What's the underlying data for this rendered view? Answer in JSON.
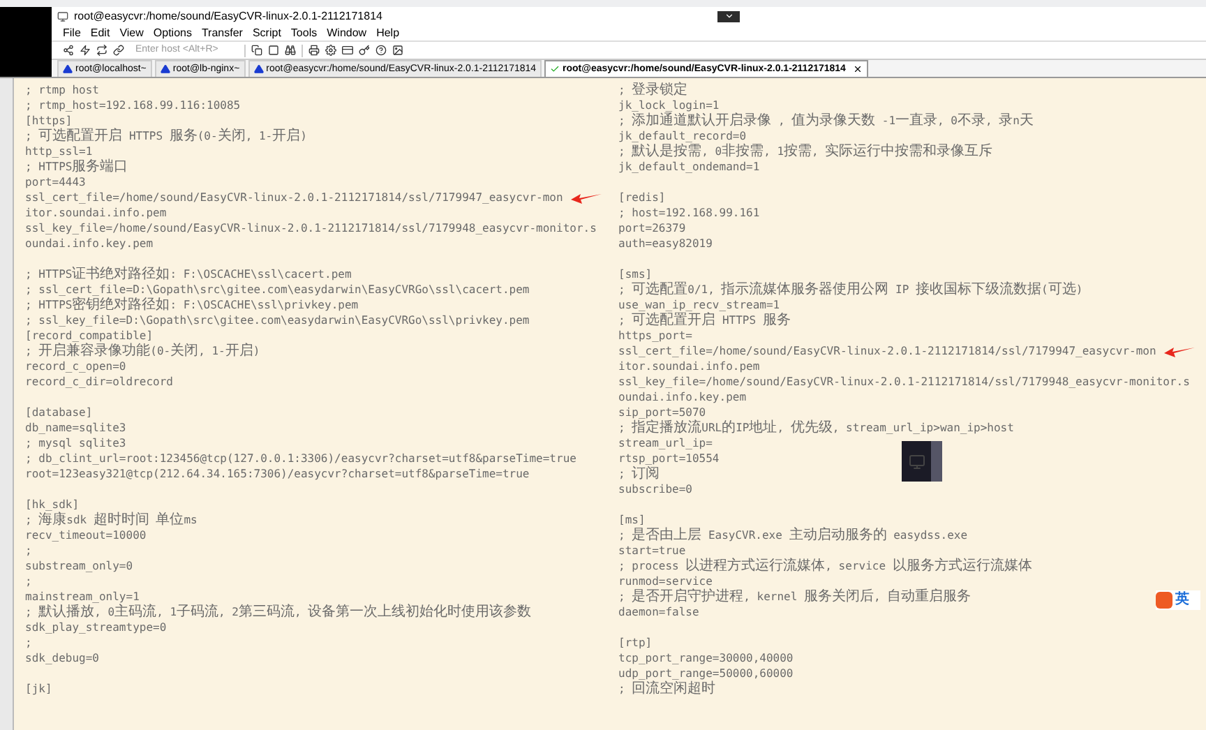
{
  "window": {
    "title": "root@easycvr:/home/sound/EasyCVR-linux-2.0.1-2112171814"
  },
  "menu": [
    "File",
    "Edit",
    "View",
    "Options",
    "Transfer",
    "Script",
    "Tools",
    "Window",
    "Help"
  ],
  "toolbar": {
    "host_field": {
      "placeholder": "Enter host <Alt+R>"
    }
  },
  "tabs": [
    {
      "label": "root@localhost~",
      "kind": "warning",
      "selected": false
    },
    {
      "label": "root@lb-nginx~",
      "kind": "warning",
      "selected": false
    },
    {
      "label": "root@easycvr:/home/sound/EasyCVR-linux-2.0.1-2112171814",
      "kind": "warning",
      "selected": false
    },
    {
      "label": "root@easycvr:/home/sound/EasyCVR-linux-2.0.1-2112171814",
      "kind": "connected",
      "selected": true
    }
  ],
  "terminal": {
    "lines": [
      {
        "kind": "text",
        "text": "; rtmp host"
      },
      {
        "kind": "text",
        "text": "; rtmp_host=192.168.99.116:10085"
      },
      {
        "kind": "text",
        "text": "[https]"
      },
      {
        "kind": "text",
        "text": "; 可选配置开启 HTTPS 服务(0-关闭, 1-开启)"
      },
      {
        "kind": "text",
        "text": "http_ssl=1"
      },
      {
        "kind": "text",
        "text": "; HTTPS服务端口"
      },
      {
        "kind": "text",
        "text": "port=4443"
      },
      {
        "kind": "arrowed",
        "text": "ssl_cert_file=/home/sound/EasyCVR-linux-2.0.1-2112171814/ssl/7179947_easycvr-monitor.soundai.info.pem"
      },
      {
        "kind": "text",
        "text": "ssl_key_file=/home/sound/EasyCVR-linux-2.0.1-2112171814/ssl/7179948_easycvr-monitor.soundai.info.key.pem"
      },
      {
        "kind": "blank"
      },
      {
        "kind": "text",
        "text": "; HTTPS证书绝对路径如: F:\\OSCACHE\\ssl\\cacert.pem"
      },
      {
        "kind": "text",
        "text": "; ssl_cert_file=D:\\Gopath\\src\\gitee.com\\easydarwin\\EasyCVRGo\\ssl\\cacert.pem"
      },
      {
        "kind": "text",
        "text": "; HTTPS密钥绝对路径如: F:\\OSCACHE\\ssl\\privkey.pem"
      },
      {
        "kind": "text",
        "text": "; ssl_key_file=D:\\Gopath\\src\\gitee.com\\easydarwin\\EasyCVRGo\\ssl\\privkey.pem"
      },
      {
        "kind": "text",
        "text": "[record_compatible]"
      },
      {
        "kind": "text",
        "text": "; 开启兼容录像功能(0-关闭, 1-开启)"
      },
      {
        "kind": "text",
        "text": "record_c_open=0"
      },
      {
        "kind": "text",
        "text": "record_c_dir=oldrecord"
      },
      {
        "kind": "blank"
      },
      {
        "kind": "text",
        "text": "[database]"
      },
      {
        "kind": "text",
        "text": "db_name=sqlite3"
      },
      {
        "kind": "text",
        "text": "; mysql sqlite3"
      },
      {
        "kind": "text",
        "text": "; db_clint_url=root:123456@tcp(127.0.0.1:3306)/easycvr?charset=utf8&parseTime=true"
      },
      {
        "kind": "text",
        "text": "root=123easy321@tcp(212.64.34.165:7306)/easycvr?charset=utf8&parseTime=true"
      },
      {
        "kind": "blank"
      },
      {
        "kind": "text",
        "text": "[hk_sdk]"
      },
      {
        "kind": "text",
        "text": "; 海康sdk 超时时间 单位ms"
      },
      {
        "kind": "text",
        "text": "recv_timeout=10000"
      },
      {
        "kind": "text",
        "text": ";"
      },
      {
        "kind": "text",
        "text": "substream_only=0"
      },
      {
        "kind": "text",
        "text": ";"
      },
      {
        "kind": "text",
        "text": "mainstream_only=1"
      },
      {
        "kind": "text",
        "text": "; 默认播放, 0主码流, 1子码流, 2第三码流, 设备第一次上线初始化时使用该参数"
      },
      {
        "kind": "text",
        "text": "sdk_play_streamtype=0"
      },
      {
        "kind": "text",
        "text": ";"
      },
      {
        "kind": "text",
        "text": "sdk_debug=0"
      },
      {
        "kind": "blank"
      },
      {
        "kind": "text",
        "text": "[jk]"
      },
      {
        "kind": "text",
        "text": "; 登录锁定"
      },
      {
        "kind": "text",
        "text": "jk_lock_login=1"
      },
      {
        "kind": "text",
        "text": "; 添加通道默认开启录像 , 值为录像天数 -1一直录, 0不录, 录n天"
      },
      {
        "kind": "text",
        "text": "jk_default_record=0"
      },
      {
        "kind": "text",
        "text": "; 默认是按需, 0非按需, 1按需, 实际运行中按需和录像互斥"
      },
      {
        "kind": "text",
        "text": "jk_default_ondemand=1"
      },
      {
        "kind": "blank"
      },
      {
        "kind": "text",
        "text": "[redis]"
      },
      {
        "kind": "text",
        "text": "; host=192.168.99.161"
      },
      {
        "kind": "text",
        "text": "port=26379"
      },
      {
        "kind": "text",
        "text": "auth=easy82019"
      },
      {
        "kind": "blank"
      },
      {
        "kind": "text",
        "text": "[sms]"
      },
      {
        "kind": "text",
        "text": "; 可选配置0/1, 指示流媒体服务器使用公网 IP 接收国标下级流数据(可选)"
      },
      {
        "kind": "text",
        "text": "use_wan_ip_recv_stream=1"
      },
      {
        "kind": "text",
        "text": "; 可选配置开启 HTTPS 服务"
      },
      {
        "kind": "text",
        "text": "https_port="
      },
      {
        "kind": "arrowed",
        "text": "ssl_cert_file=/home/sound/EasyCVR-linux-2.0.1-2112171814/ssl/7179947_easycvr-monitor.soundai.info.pem"
      },
      {
        "kind": "text",
        "text": "ssl_key_file=/home/sound/EasyCVR-linux-2.0.1-2112171814/ssl/7179948_easycvr-monitor.soundai.info.key.pem"
      },
      {
        "kind": "text",
        "text": "sip_port=5070"
      },
      {
        "kind": "text",
        "text": "; 指定播放流URL的IP地址, 优先级, stream_url_ip>wan_ip>host"
      },
      {
        "kind": "text",
        "text": "stream_url_ip="
      },
      {
        "kind": "text",
        "text": "rtsp_port=10554"
      },
      {
        "kind": "text",
        "text": "; 订阅"
      },
      {
        "kind": "text",
        "text": "subscribe=0"
      },
      {
        "kind": "blank"
      },
      {
        "kind": "text",
        "text": "[ms]"
      },
      {
        "kind": "text",
        "text": "; 是否由上层 EasyCVR.exe 主动启动服务的 easydss.exe"
      },
      {
        "kind": "text",
        "text": "start=true"
      },
      {
        "kind": "text",
        "text": "; process 以进程方式运行流媒体, service 以服务方式运行流媒体"
      },
      {
        "kind": "text",
        "text": "runmod=service"
      },
      {
        "kind": "text",
        "text": "; 是否开启守护进程, kernel 服务关闭后, 自动重启服务"
      },
      {
        "kind": "text",
        "text": "daemon=false"
      },
      {
        "kind": "blank"
      },
      {
        "kind": "text",
        "text": "[rtp]"
      },
      {
        "kind": "text",
        "text": "tcp_port_range=30000,40000"
      },
      {
        "kind": "text",
        "text": "udp_port_range=50000,60000"
      },
      {
        "kind": "text",
        "text": "; 回流空闲超时"
      }
    ]
  },
  "ime": {
    "label": "英"
  }
}
